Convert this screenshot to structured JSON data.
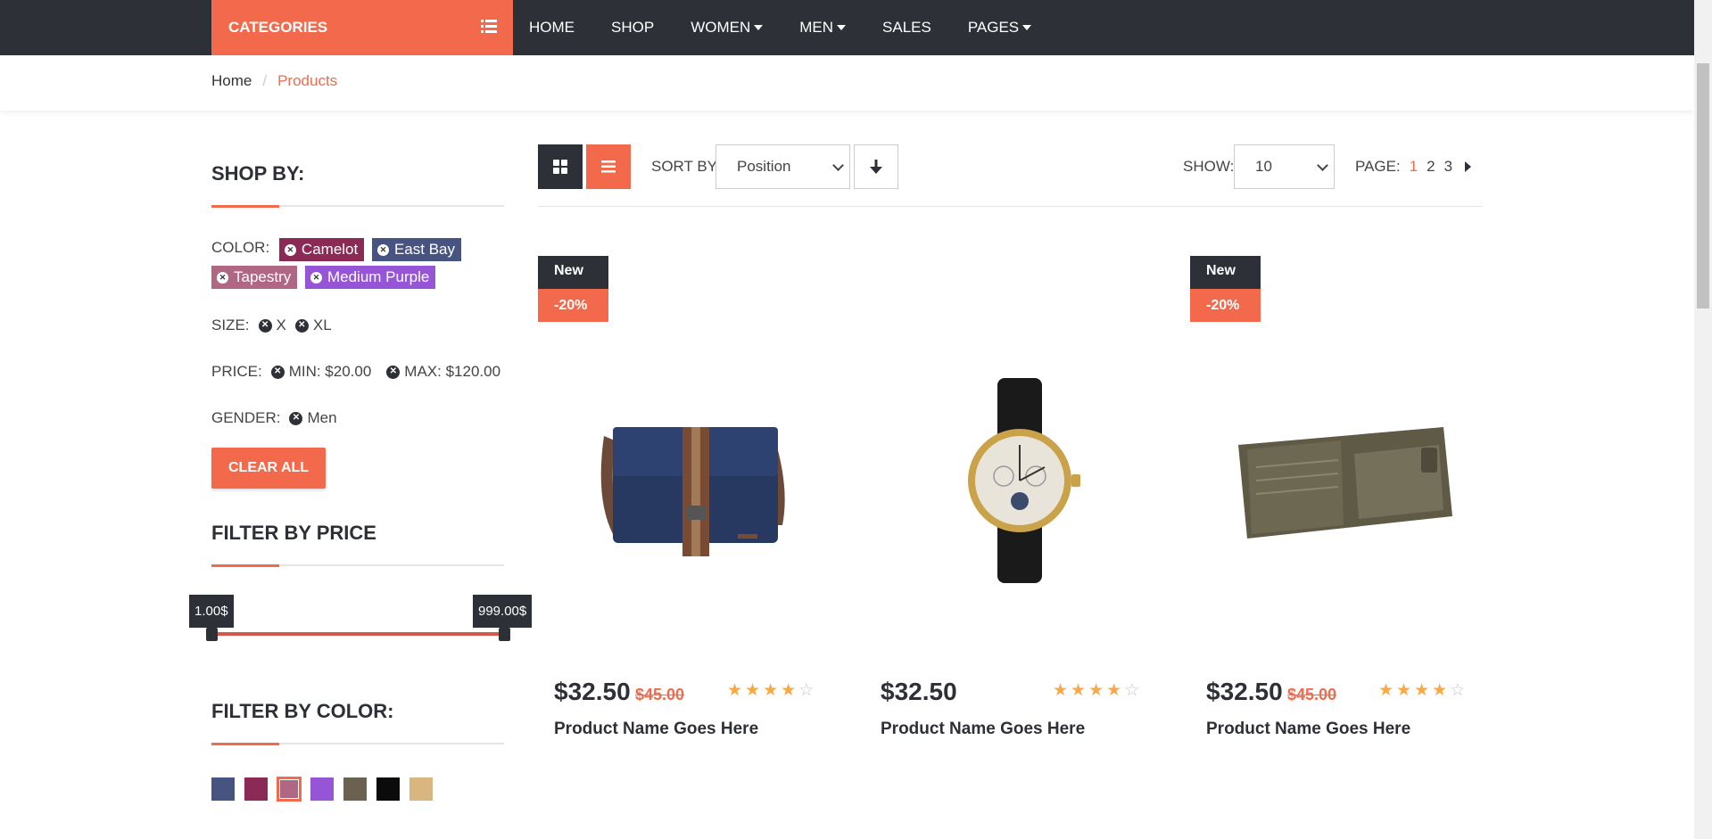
{
  "nav": {
    "categories_label": "CATEGORIES",
    "items": [
      {
        "label": "HOME",
        "dropdown": false
      },
      {
        "label": "SHOP",
        "dropdown": false
      },
      {
        "label": "WOMEN",
        "dropdown": true
      },
      {
        "label": "MEN",
        "dropdown": true
      },
      {
        "label": "SALES",
        "dropdown": false
      },
      {
        "label": "PAGES",
        "dropdown": true
      }
    ]
  },
  "breadcrumb": {
    "home": "Home",
    "separator": "/",
    "current": "Products"
  },
  "sidebar": {
    "shop_by_title": "SHOP BY:",
    "color_label": "COLOR:",
    "color_chips": [
      {
        "label": "Camelot",
        "color": "#8b2a55"
      },
      {
        "label": "East Bay",
        "color": "#475381"
      },
      {
        "label": "Tapestry",
        "color": "#b06784"
      },
      {
        "label": "Medium Purple",
        "color": "#9555d6"
      }
    ],
    "size_label": "SIZE:",
    "sizes": [
      "X",
      "XL"
    ],
    "price_label": "PRICE:",
    "price_min": "MIN: $20.00",
    "price_max": "MAX: $120.00",
    "gender_label": "GENDER:",
    "gender": "Men",
    "clear_all": "CLEAR ALL",
    "filter_price_title": "FILTER BY PRICE",
    "price_slider": {
      "min_label": "1.00$",
      "max_label": "999.00$"
    },
    "filter_color_title": "FILTER BY COLOR:",
    "swatches": [
      "#475381",
      "#8b2a55",
      "#b06784",
      "#9555d6",
      "#6b6150",
      "#0b0b0b",
      "#d9b67f"
    ],
    "selected_swatch": 2
  },
  "toolbar": {
    "sort_label": "SORT BY:",
    "sort_value": "Position",
    "show_label": "SHOW:",
    "show_value": "10",
    "page_label": "PAGE:",
    "pages": [
      "1",
      "2",
      "3"
    ],
    "current_page": "1"
  },
  "products": [
    {
      "badge_new": "New",
      "badge_discount": "-20%",
      "price": "$32.50",
      "old_price": "$45.00",
      "rating": 4,
      "name": "Product Name Goes Here",
      "image": "messenger-bag"
    },
    {
      "badge_new": "",
      "badge_discount": "",
      "price": "$32.50",
      "old_price": "",
      "rating": 4,
      "name": "Product Name Goes Here",
      "image": "wrist-watch"
    },
    {
      "badge_new": "New",
      "badge_discount": "-20%",
      "price": "$32.50",
      "old_price": "$45.00",
      "rating": 4,
      "name": "Product Name Goes Here",
      "image": "wallet"
    }
  ],
  "colors": {
    "accent": "#f26a4b",
    "dark": "#2d3037"
  }
}
